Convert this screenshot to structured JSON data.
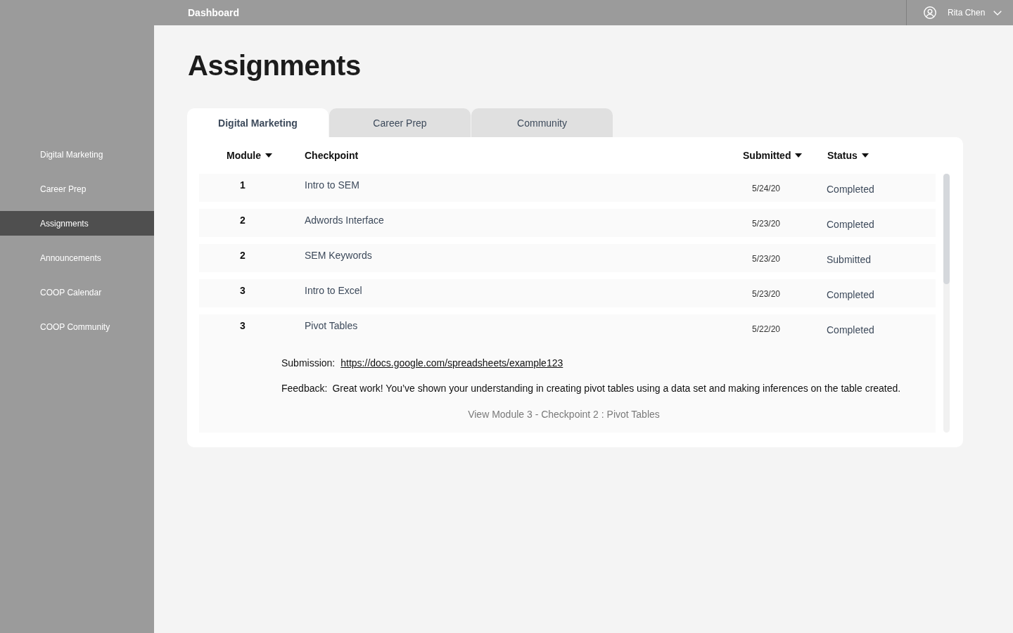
{
  "top_bar": {
    "title": "Dashboard",
    "user_name": "Rita Chen"
  },
  "sidebar": {
    "items": [
      {
        "label": "Digital Marketing",
        "selected": false
      },
      {
        "label": "Career Prep",
        "selected": false
      },
      {
        "label": "Assignments",
        "selected": true
      },
      {
        "label": "Announcements",
        "selected": false
      },
      {
        "label": "COOP Calendar",
        "selected": false
      },
      {
        "label": "COOP Community",
        "selected": false
      }
    ]
  },
  "page_title": "Assignments",
  "tabs": [
    {
      "label": "Digital Marketing",
      "selected": true
    },
    {
      "label": "Career Prep",
      "selected": false
    },
    {
      "label": "Community",
      "selected": false
    }
  ],
  "table": {
    "columns": [
      {
        "label": "Module",
        "sortable": true
      },
      {
        "label": "Checkpoint",
        "sortable": false
      },
      {
        "label": "Submitted",
        "sortable": true
      },
      {
        "label": "Status",
        "sortable": true
      }
    ],
    "rows": [
      {
        "module": "1",
        "checkpoint": "Intro to SEM",
        "submitted": "5/24/20",
        "status": "Completed"
      },
      {
        "module": "2",
        "checkpoint": "Adwords Interface",
        "submitted": "5/23/20",
        "status": "Completed"
      },
      {
        "module": "2",
        "checkpoint": "SEM Keywords",
        "submitted": "5/23/20",
        "status": "Submitted"
      },
      {
        "module": "3",
        "checkpoint": "Intro to Excel",
        "submitted": "5/23/20",
        "status": "Completed"
      },
      {
        "module": "3",
        "checkpoint": "Pivot Tables",
        "submitted": "5/22/20",
        "status": "Completed",
        "details": {
          "submission_label": "Submission:",
          "submission_link": "https://docs.google.com/spreadsheets/example123",
          "feedback_label": "Feedback:",
          "feedback": "Great work! You’ve shown your understanding in creating pivot tables using a data set and making inferences on the table created.",
          "view_link": "View Module 3 - Checkpoint 2 : Pivot Tables"
        }
      }
    ]
  }
}
